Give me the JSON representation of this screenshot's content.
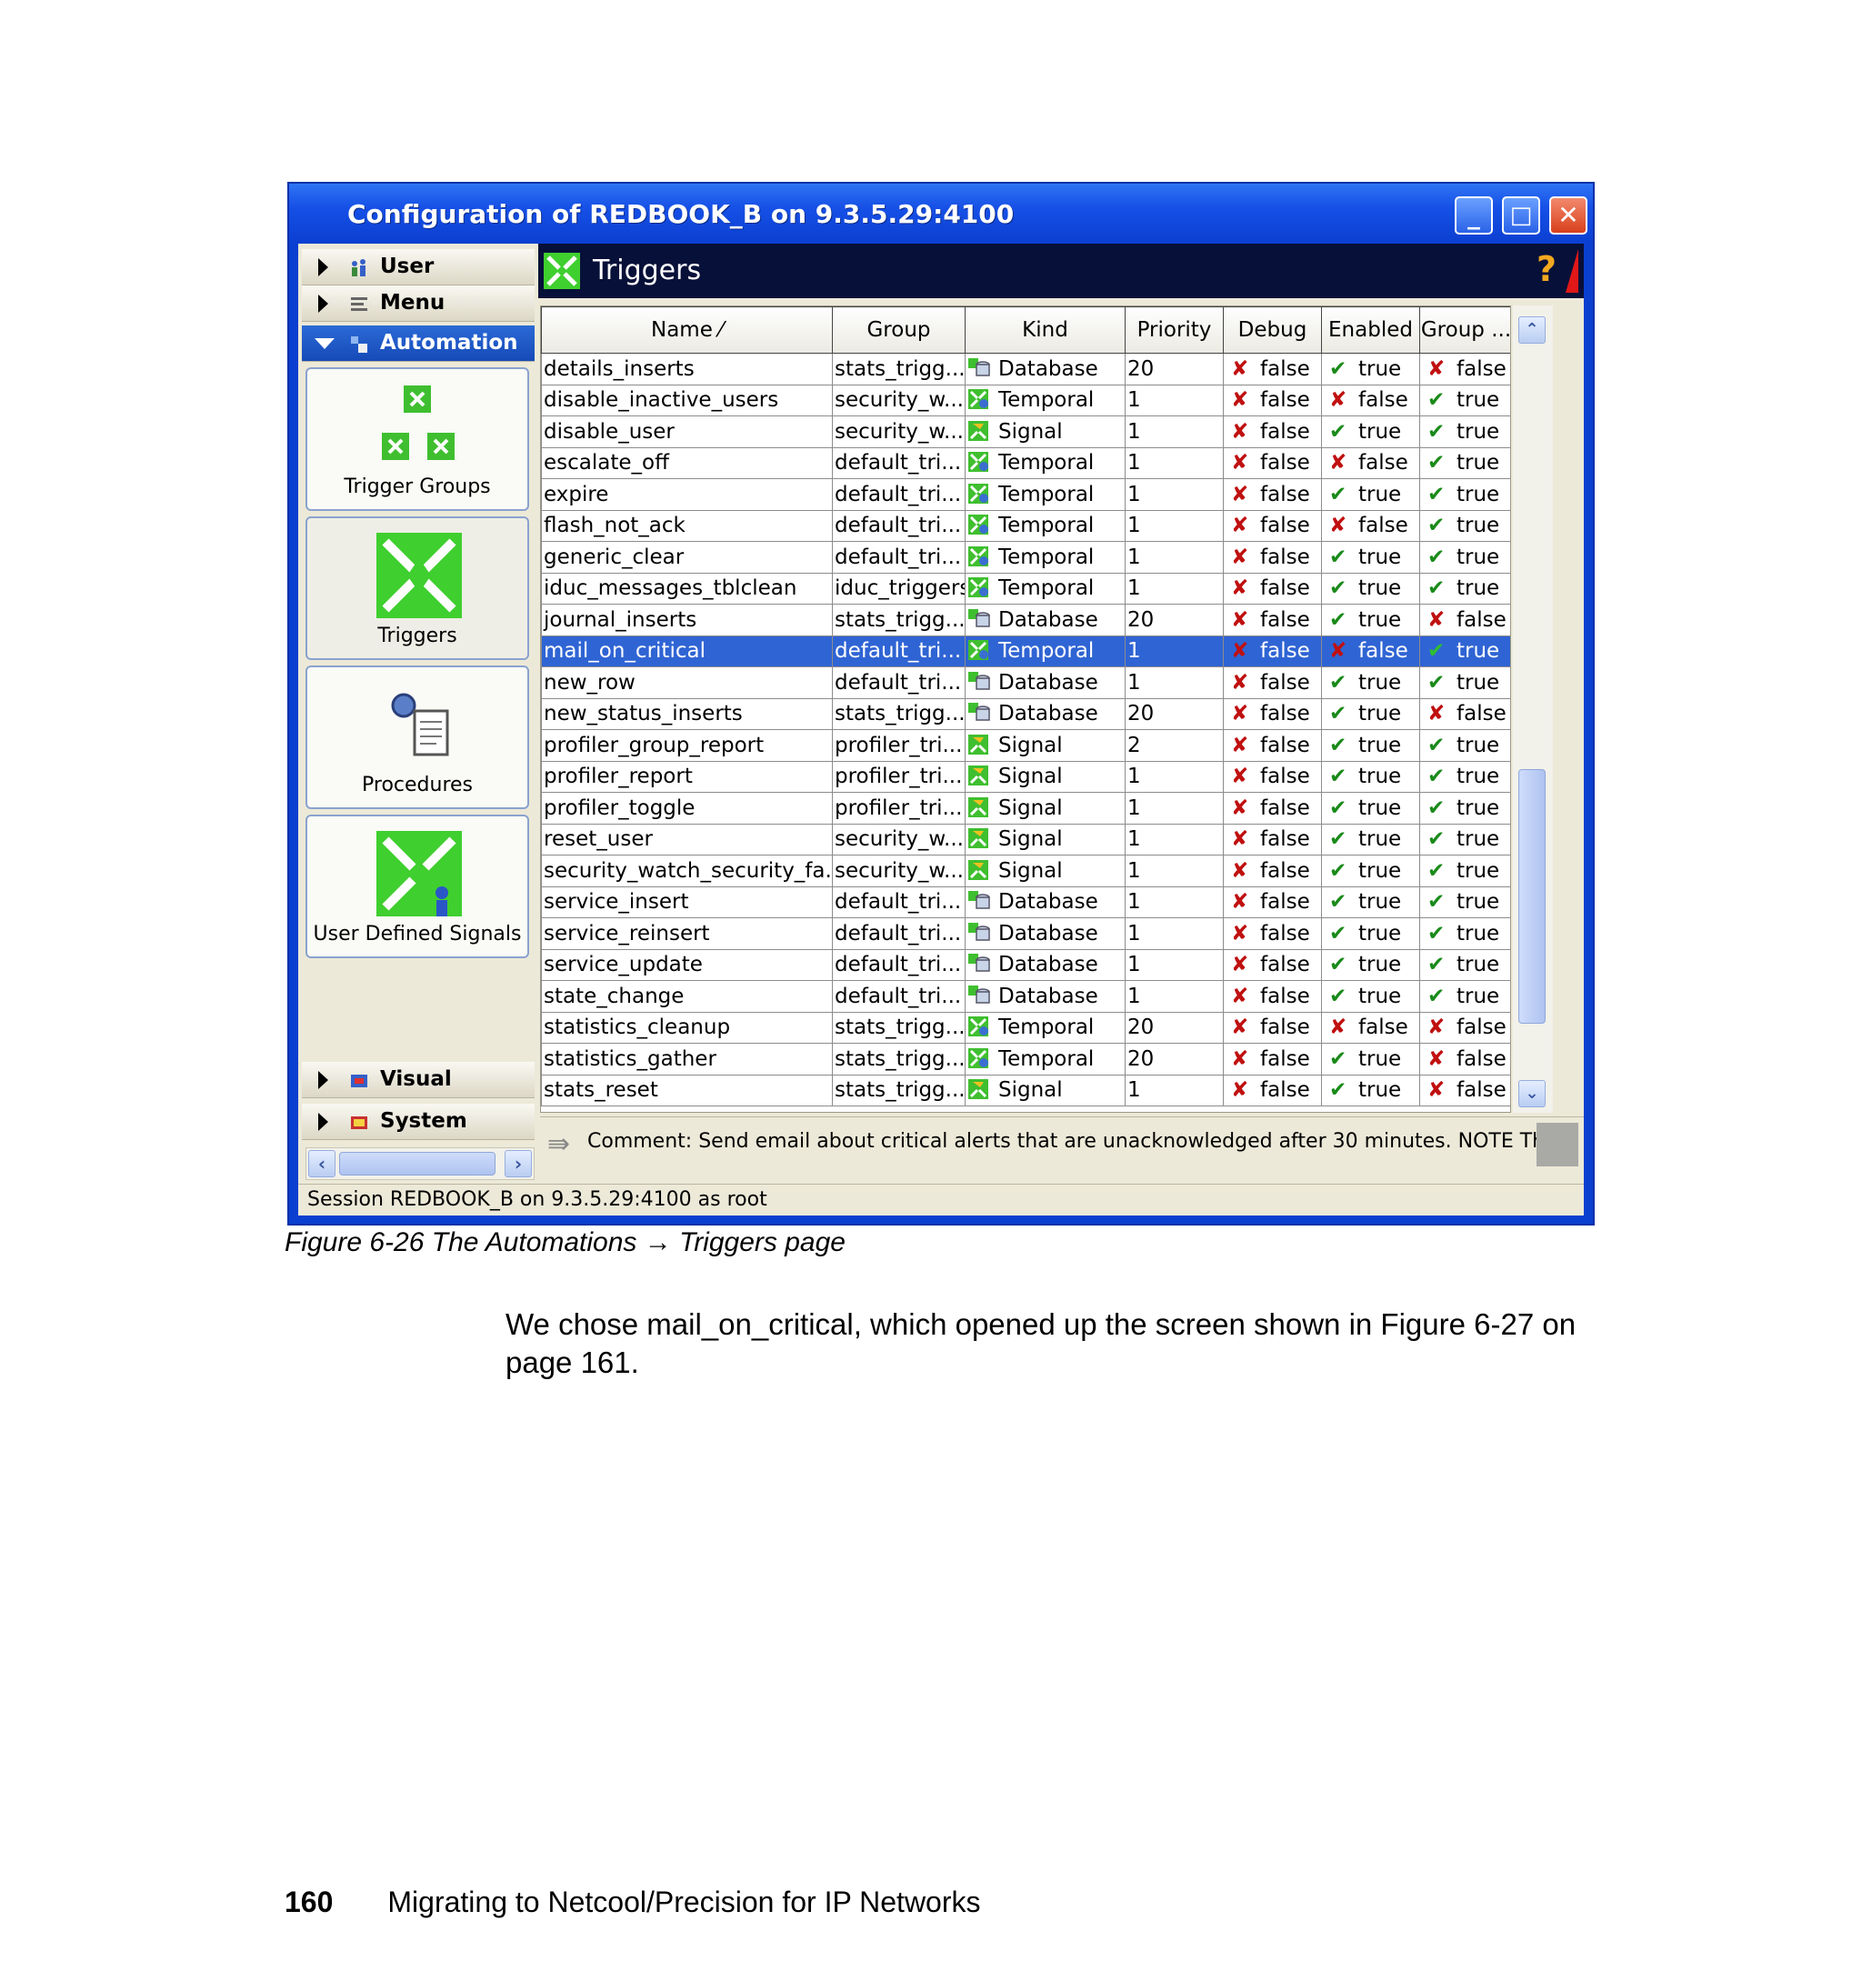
{
  "window": {
    "title": "Configuration of REDBOOK_B on 9.3.5.29:4100",
    "minimize_glyph": "_",
    "maximize_glyph": "□",
    "close_glyph": "✕"
  },
  "nav": {
    "sections_top": [
      {
        "label": "User",
        "icon": "users-icon"
      },
      {
        "label": "Menu",
        "icon": "menu-icon"
      }
    ],
    "active_section": {
      "label": "Automation",
      "icon": "automation-icon"
    },
    "items": [
      {
        "label": "Trigger Groups",
        "icon": "trigger-groups-icon"
      },
      {
        "label": "Triggers",
        "icon": "triggers-icon"
      },
      {
        "label": "Procedures",
        "icon": "procedures-icon"
      },
      {
        "label": "User Defined Signals",
        "icon": "user-defined-signals-icon"
      }
    ],
    "sections_bottom": [
      {
        "label": "Visual",
        "icon": "visual-icon"
      },
      {
        "label": "System",
        "icon": "system-icon"
      }
    ]
  },
  "pane": {
    "title": "Triggers",
    "help_glyph": "?"
  },
  "table": {
    "columns": [
      "Name ⁄",
      "Group",
      "Kind",
      "Priority",
      "Debug",
      "Enabled",
      "Group ..."
    ],
    "rows": [
      {
        "name": "details_inserts",
        "group": "stats_trigg...",
        "kind": "Database",
        "priority": "20",
        "debug": "false",
        "enabled": "true",
        "group_enabled": "false"
      },
      {
        "name": "disable_inactive_users",
        "group": "security_w...",
        "kind": "Temporal",
        "priority": "1",
        "debug": "false",
        "enabled": "false",
        "group_enabled": "true"
      },
      {
        "name": "disable_user",
        "group": "security_w...",
        "kind": "Signal",
        "priority": "1",
        "debug": "false",
        "enabled": "true",
        "group_enabled": "true"
      },
      {
        "name": "escalate_off",
        "group": "default_tri...",
        "kind": "Temporal",
        "priority": "1",
        "debug": "false",
        "enabled": "false",
        "group_enabled": "true"
      },
      {
        "name": "expire",
        "group": "default_tri...",
        "kind": "Temporal",
        "priority": "1",
        "debug": "false",
        "enabled": "true",
        "group_enabled": "true"
      },
      {
        "name": "flash_not_ack",
        "group": "default_tri...",
        "kind": "Temporal",
        "priority": "1",
        "debug": "false",
        "enabled": "false",
        "group_enabled": "true"
      },
      {
        "name": "generic_clear",
        "group": "default_tri...",
        "kind": "Temporal",
        "priority": "1",
        "debug": "false",
        "enabled": "true",
        "group_enabled": "true"
      },
      {
        "name": "iduc_messages_tblclean",
        "group": "iduc_triggers",
        "kind": "Temporal",
        "priority": "1",
        "debug": "false",
        "enabled": "true",
        "group_enabled": "true"
      },
      {
        "name": "journal_inserts",
        "group": "stats_trigg...",
        "kind": "Database",
        "priority": "20",
        "debug": "false",
        "enabled": "true",
        "group_enabled": "false"
      },
      {
        "name": "mail_on_critical",
        "group": "default_tri...",
        "kind": "Temporal",
        "priority": "1",
        "debug": "false",
        "enabled": "false",
        "group_enabled": "true",
        "selected": true
      },
      {
        "name": "new_row",
        "group": "default_tri...",
        "kind": "Database",
        "priority": "1",
        "debug": "false",
        "enabled": "true",
        "group_enabled": "true"
      },
      {
        "name": "new_status_inserts",
        "group": "stats_trigg...",
        "kind": "Database",
        "priority": "20",
        "debug": "false",
        "enabled": "true",
        "group_enabled": "false"
      },
      {
        "name": "profiler_group_report",
        "group": "profiler_tri...",
        "kind": "Signal",
        "priority": "2",
        "debug": "false",
        "enabled": "true",
        "group_enabled": "true"
      },
      {
        "name": "profiler_report",
        "group": "profiler_tri...",
        "kind": "Signal",
        "priority": "1",
        "debug": "false",
        "enabled": "true",
        "group_enabled": "true"
      },
      {
        "name": "profiler_toggle",
        "group": "profiler_tri...",
        "kind": "Signal",
        "priority": "1",
        "debug": "false",
        "enabled": "true",
        "group_enabled": "true"
      },
      {
        "name": "reset_user",
        "group": "security_w...",
        "kind": "Signal",
        "priority": "1",
        "debug": "false",
        "enabled": "true",
        "group_enabled": "true"
      },
      {
        "name": "security_watch_security_fa...",
        "group": "security_w...",
        "kind": "Signal",
        "priority": "1",
        "debug": "false",
        "enabled": "true",
        "group_enabled": "true"
      },
      {
        "name": "service_insert",
        "group": "default_tri...",
        "kind": "Database",
        "priority": "1",
        "debug": "false",
        "enabled": "true",
        "group_enabled": "true"
      },
      {
        "name": "service_reinsert",
        "group": "default_tri...",
        "kind": "Database",
        "priority": "1",
        "debug": "false",
        "enabled": "true",
        "group_enabled": "true"
      },
      {
        "name": "service_update",
        "group": "default_tri...",
        "kind": "Database",
        "priority": "1",
        "debug": "false",
        "enabled": "true",
        "group_enabled": "true"
      },
      {
        "name": "state_change",
        "group": "default_tri...",
        "kind": "Database",
        "priority": "1",
        "debug": "false",
        "enabled": "true",
        "group_enabled": "true"
      },
      {
        "name": "statistics_cleanup",
        "group": "stats_trigg...",
        "kind": "Temporal",
        "priority": "20",
        "debug": "false",
        "enabled": "false",
        "group_enabled": "false"
      },
      {
        "name": "statistics_gather",
        "group": "stats_trigg...",
        "kind": "Temporal",
        "priority": "20",
        "debug": "false",
        "enabled": "true",
        "group_enabled": "false"
      },
      {
        "name": "stats_reset",
        "group": "stats_trigg...",
        "kind": "Signal",
        "priority": "1",
        "debug": "false",
        "enabled": "true",
        "group_enabled": "false"
      }
    ]
  },
  "comment": "Comment: Send email about critical alerts that are unacknowledged after 30 minutes. NOTE This...",
  "status": "Session REDBOOK_B on 9.3.5.29:4100  as root",
  "document": {
    "caption": "Figure 6-26   The Automations → Triggers page",
    "body": "We chose mail_on_critical, which opened up the screen shown in Figure 6-27 on page 161.",
    "page_number": "160",
    "footer_title": "Migrating to Netcool/Precision for IP Networks"
  },
  "colors": {
    "titlebar": "#1650e6",
    "selection": "#2f64d4",
    "pane_header": "#071038",
    "check_true": "#1a8a1a",
    "cross_false": "#c01010"
  }
}
